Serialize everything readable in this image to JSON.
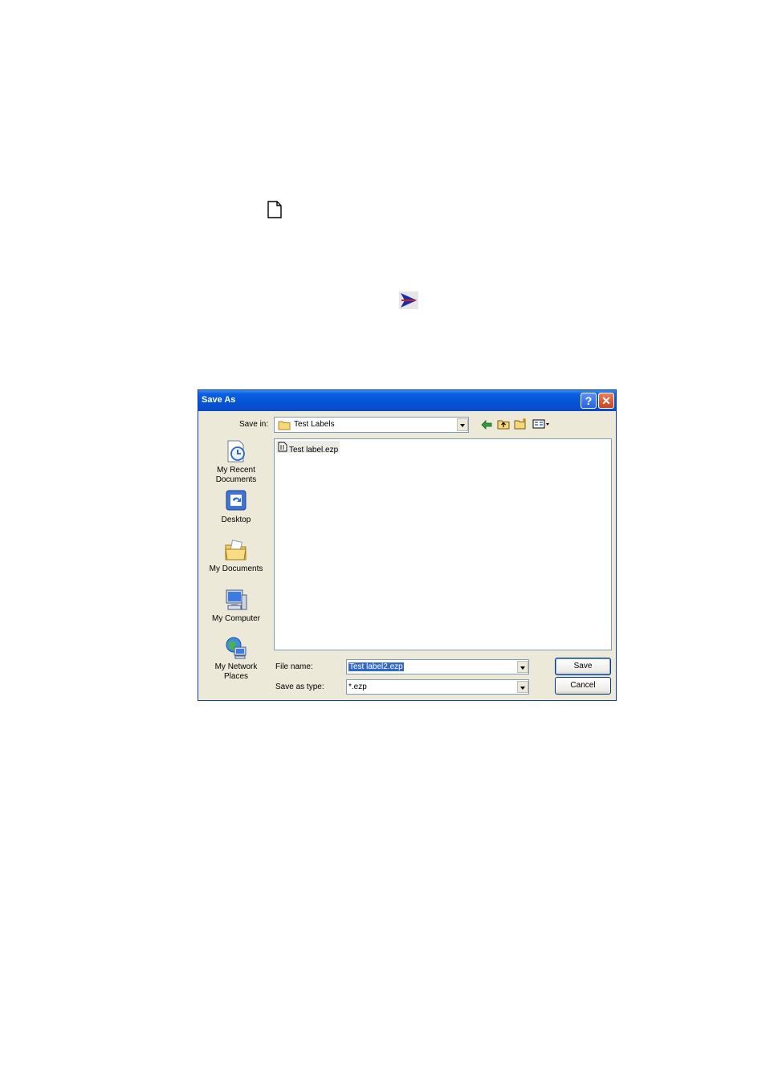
{
  "page_icons": {
    "new_document": "new-document-icon",
    "send": "send-arrow-icon"
  },
  "dialog": {
    "title": "Save As",
    "help_glyph": "?",
    "close_glyph": "✕",
    "save_in_label": "Save in:",
    "save_in_value": "Test Labels",
    "toolbar": [
      "back-arrow-icon",
      "up-folder-icon",
      "new-folder-icon",
      "views-menu-icon"
    ],
    "places": [
      {
        "label": "My Recent Documents",
        "icon": "recent-documents-icon"
      },
      {
        "label": "Desktop",
        "icon": "desktop-icon"
      },
      {
        "label": "My Documents",
        "icon": "my-documents-icon"
      },
      {
        "label": "My Computer",
        "icon": "my-computer-icon"
      },
      {
        "label": "My Network Places",
        "icon": "network-places-icon"
      }
    ],
    "files": [
      {
        "name": "Test label.ezp"
      }
    ],
    "file_name_label": "File name:",
    "file_name_value": "Test label2.ezp",
    "save_as_type_label": "Save as type:",
    "save_as_type_value": "*.ezp",
    "save_button": "Save",
    "cancel_button": "Cancel"
  }
}
